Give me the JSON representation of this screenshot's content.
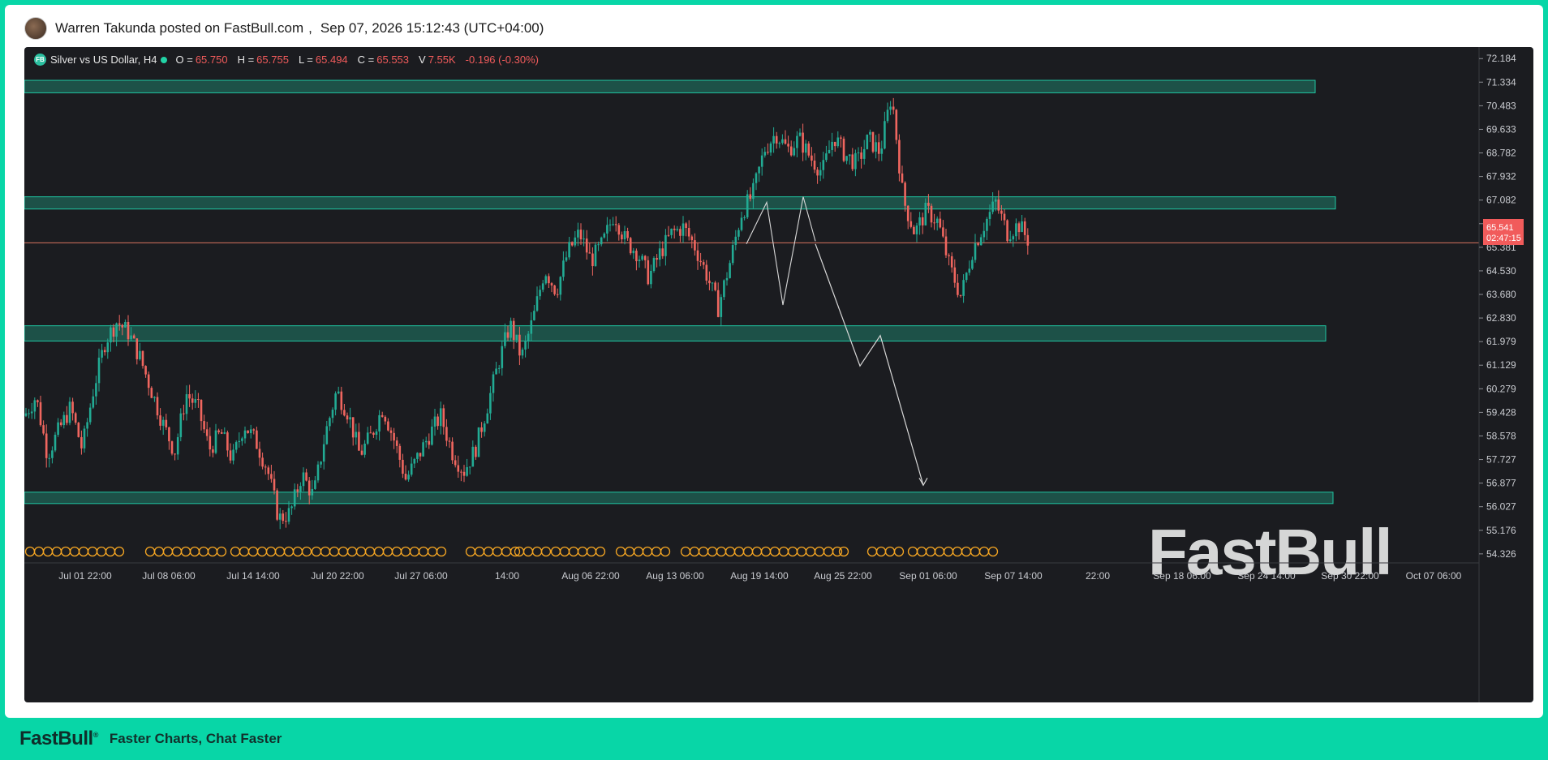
{
  "post": {
    "author_line": "Warren Takunda posted on FastBull.com",
    "separator": ",",
    "timestamp": "Sep 07, 2026 15:12:43 (UTC+04:00)"
  },
  "legend": {
    "badge": "FB",
    "symbol": "Silver vs US Dollar, H4",
    "open_label": "O =",
    "open": "65.750",
    "high_label": "H =",
    "high": "65.755",
    "low_label": "L =",
    "low": "65.494",
    "close_label": "C =",
    "close": "65.553",
    "volume_label": "V",
    "volume": "7.55K",
    "change": "-0.196 (-0.30%)"
  },
  "price_tag": {
    "price": "65.541",
    "countdown": "02:47:15"
  },
  "watermark": "FastBull",
  "footer": {
    "brand": "FastBull",
    "reg": "®",
    "tagline": "Faster Charts, Chat Faster"
  },
  "colors": {
    "up": "#22ab94",
    "down": "#f0665f",
    "zone_fill": "#1d5b50",
    "zone_border": "#20c7a3",
    "background": "#1b1c20",
    "price_tag": "#f15b5b",
    "event_icon": "#f5a623"
  },
  "chart_data": {
    "type": "candlestick",
    "symbol": "Silver vs US Dollar",
    "timeframe": "H4",
    "y_ticks": [
      "72.184",
      "71.334",
      "70.483",
      "69.633",
      "68.782",
      "67.932",
      "67.082",
      "66.231",
      "65.381",
      "64.530",
      "63.680",
      "62.830",
      "61.979",
      "61.129",
      "60.279",
      "59.428",
      "58.578",
      "57.727",
      "56.877",
      "56.027",
      "55.176",
      "54.326"
    ],
    "ylim": [
      54.0,
      72.6
    ],
    "x_ticks": [
      "Jul 01 22:00",
      "Jul 08 06:00",
      "Jul 14 14:00",
      "Jul 20 22:00",
      "Jul 27 06:00",
      "14:00",
      "Aug 06 22:00",
      "Aug 13 06:00",
      "Aug 19 14:00",
      "Aug 25 22:00",
      "Sep 01 06:00",
      "Sep 07 14:00",
      "22:00",
      "Sep 18 06:00",
      "Sep 24 14:00",
      "Sep 30 22:00",
      "Oct 07 06:00"
    ],
    "anchors": [
      [
        0,
        59.3
      ],
      [
        1,
        60.0
      ],
      [
        2,
        57.9
      ],
      [
        3,
        58.8
      ],
      [
        4,
        59.6
      ],
      [
        5,
        58.1
      ],
      [
        6,
        60.3
      ],
      [
        7,
        62.0
      ],
      [
        8,
        62.7
      ],
      [
        9,
        62.3
      ],
      [
        10,
        61.4
      ],
      [
        11,
        60.2
      ],
      [
        12,
        59.0
      ],
      [
        13,
        58.0
      ],
      [
        14,
        60.1
      ],
      [
        15,
        59.6
      ],
      [
        16,
        58.1
      ],
      [
        17,
        58.7
      ],
      [
        18,
        57.7
      ],
      [
        19,
        59.0
      ],
      [
        20,
        58.4
      ],
      [
        21,
        57.4
      ],
      [
        22,
        55.6
      ],
      [
        23,
        55.8
      ],
      [
        24,
        57.2
      ],
      [
        25,
        56.4
      ],
      [
        26,
        58.6
      ],
      [
        27,
        60.2
      ],
      [
        28,
        59.4
      ],
      [
        29,
        57.9
      ],
      [
        30,
        58.6
      ],
      [
        31,
        59.6
      ],
      [
        32,
        58.4
      ],
      [
        33,
        57.0
      ],
      [
        34,
        57.8
      ],
      [
        35,
        58.6
      ],
      [
        36,
        59.3
      ],
      [
        37,
        58.0
      ],
      [
        38,
        57.3
      ],
      [
        39,
        58.1
      ],
      [
        40,
        59.6
      ],
      [
        41,
        61.2
      ],
      [
        42,
        62.6
      ],
      [
        43,
        61.4
      ],
      [
        44,
        62.8
      ],
      [
        45,
        64.6
      ],
      [
        46,
        63.8
      ],
      [
        47,
        65.2
      ],
      [
        48,
        65.9
      ],
      [
        49,
        64.9
      ],
      [
        50,
        65.5
      ],
      [
        51,
        66.6
      ],
      [
        52,
        65.6
      ],
      [
        53,
        65.2
      ],
      [
        54,
        64.3
      ],
      [
        55,
        65.2
      ],
      [
        56,
        65.9
      ],
      [
        57,
        66.1
      ],
      [
        58,
        65.4
      ],
      [
        59,
        64.4
      ],
      [
        60,
        63.2
      ],
      [
        61,
        64.8
      ],
      [
        62,
        66.6
      ],
      [
        63,
        67.3
      ],
      [
        64,
        68.9
      ],
      [
        65,
        69.5
      ],
      [
        66,
        68.9
      ],
      [
        67,
        69.3
      ],
      [
        68,
        68.6
      ],
      [
        69,
        68.1
      ],
      [
        70,
        69.4
      ],
      [
        71,
        68.7
      ],
      [
        72,
        68.4
      ],
      [
        73,
        69.3
      ],
      [
        74,
        68.8
      ],
      [
        75,
        70.9
      ],
      [
        76,
        67.1
      ],
      [
        77,
        65.9
      ],
      [
        78,
        66.7
      ],
      [
        79,
        66.3
      ],
      [
        80,
        64.7
      ],
      [
        81,
        63.6
      ],
      [
        82,
        65.3
      ],
      [
        83,
        66.2
      ],
      [
        84,
        67.0
      ],
      [
        85,
        65.9
      ],
      [
        86,
        66.2
      ],
      [
        87,
        65.5
      ]
    ],
    "support_resistance_zones": [
      {
        "low": 70.95,
        "high": 71.4
      },
      {
        "low": 66.76,
        "high": 67.2
      },
      {
        "low": 62.0,
        "high": 62.55
      },
      {
        "low": 56.14,
        "high": 56.55
      }
    ],
    "current_price": 65.541,
    "projection_path": [
      {
        "x": "Sep 07 18:00",
        "y": 65.5
      },
      {
        "x": "Sep 10 06:00",
        "y": 61.1
      },
      {
        "x": "Sep 11 06:00",
        "y": 62.2
      },
      {
        "x": "Sep 15 18:00",
        "y": 56.8
      }
    ]
  }
}
